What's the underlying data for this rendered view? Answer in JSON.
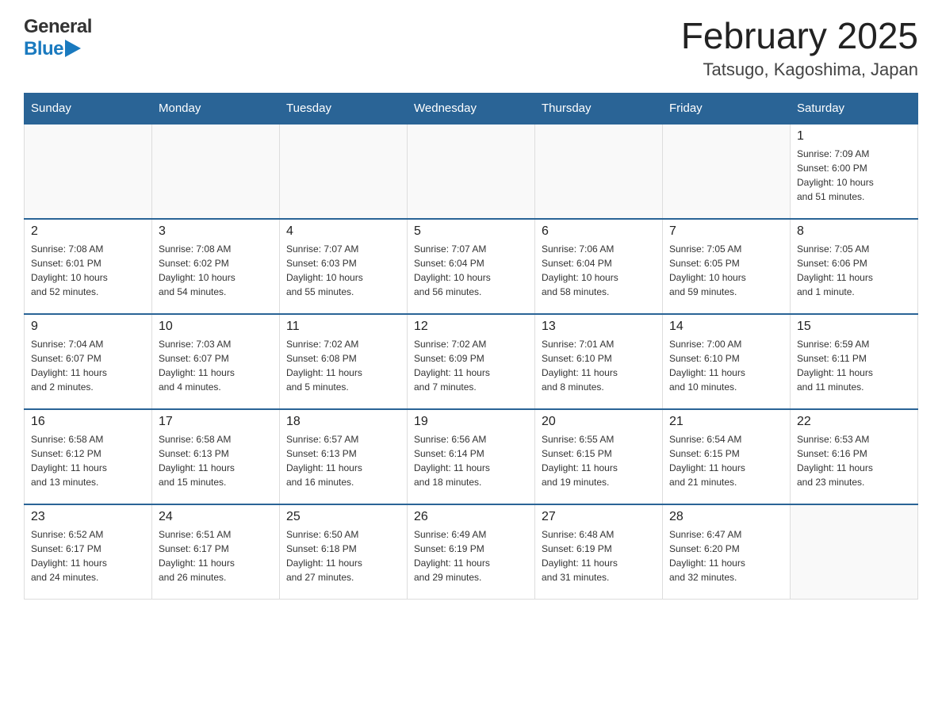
{
  "header": {
    "logo_line1": "General",
    "logo_line2": "Blue",
    "month_title": "February 2025",
    "location": "Tatsugo, Kagoshima, Japan"
  },
  "days_of_week": [
    "Sunday",
    "Monday",
    "Tuesday",
    "Wednesday",
    "Thursday",
    "Friday",
    "Saturday"
  ],
  "weeks": [
    [
      {
        "day": "",
        "info": ""
      },
      {
        "day": "",
        "info": ""
      },
      {
        "day": "",
        "info": ""
      },
      {
        "day": "",
        "info": ""
      },
      {
        "day": "",
        "info": ""
      },
      {
        "day": "",
        "info": ""
      },
      {
        "day": "1",
        "info": "Sunrise: 7:09 AM\nSunset: 6:00 PM\nDaylight: 10 hours\nand 51 minutes."
      }
    ],
    [
      {
        "day": "2",
        "info": "Sunrise: 7:08 AM\nSunset: 6:01 PM\nDaylight: 10 hours\nand 52 minutes."
      },
      {
        "day": "3",
        "info": "Sunrise: 7:08 AM\nSunset: 6:02 PM\nDaylight: 10 hours\nand 54 minutes."
      },
      {
        "day": "4",
        "info": "Sunrise: 7:07 AM\nSunset: 6:03 PM\nDaylight: 10 hours\nand 55 minutes."
      },
      {
        "day": "5",
        "info": "Sunrise: 7:07 AM\nSunset: 6:04 PM\nDaylight: 10 hours\nand 56 minutes."
      },
      {
        "day": "6",
        "info": "Sunrise: 7:06 AM\nSunset: 6:04 PM\nDaylight: 10 hours\nand 58 minutes."
      },
      {
        "day": "7",
        "info": "Sunrise: 7:05 AM\nSunset: 6:05 PM\nDaylight: 10 hours\nand 59 minutes."
      },
      {
        "day": "8",
        "info": "Sunrise: 7:05 AM\nSunset: 6:06 PM\nDaylight: 11 hours\nand 1 minute."
      }
    ],
    [
      {
        "day": "9",
        "info": "Sunrise: 7:04 AM\nSunset: 6:07 PM\nDaylight: 11 hours\nand 2 minutes."
      },
      {
        "day": "10",
        "info": "Sunrise: 7:03 AM\nSunset: 6:07 PM\nDaylight: 11 hours\nand 4 minutes."
      },
      {
        "day": "11",
        "info": "Sunrise: 7:02 AM\nSunset: 6:08 PM\nDaylight: 11 hours\nand 5 minutes."
      },
      {
        "day": "12",
        "info": "Sunrise: 7:02 AM\nSunset: 6:09 PM\nDaylight: 11 hours\nand 7 minutes."
      },
      {
        "day": "13",
        "info": "Sunrise: 7:01 AM\nSunset: 6:10 PM\nDaylight: 11 hours\nand 8 minutes."
      },
      {
        "day": "14",
        "info": "Sunrise: 7:00 AM\nSunset: 6:10 PM\nDaylight: 11 hours\nand 10 minutes."
      },
      {
        "day": "15",
        "info": "Sunrise: 6:59 AM\nSunset: 6:11 PM\nDaylight: 11 hours\nand 11 minutes."
      }
    ],
    [
      {
        "day": "16",
        "info": "Sunrise: 6:58 AM\nSunset: 6:12 PM\nDaylight: 11 hours\nand 13 minutes."
      },
      {
        "day": "17",
        "info": "Sunrise: 6:58 AM\nSunset: 6:13 PM\nDaylight: 11 hours\nand 15 minutes."
      },
      {
        "day": "18",
        "info": "Sunrise: 6:57 AM\nSunset: 6:13 PM\nDaylight: 11 hours\nand 16 minutes."
      },
      {
        "day": "19",
        "info": "Sunrise: 6:56 AM\nSunset: 6:14 PM\nDaylight: 11 hours\nand 18 minutes."
      },
      {
        "day": "20",
        "info": "Sunrise: 6:55 AM\nSunset: 6:15 PM\nDaylight: 11 hours\nand 19 minutes."
      },
      {
        "day": "21",
        "info": "Sunrise: 6:54 AM\nSunset: 6:15 PM\nDaylight: 11 hours\nand 21 minutes."
      },
      {
        "day": "22",
        "info": "Sunrise: 6:53 AM\nSunset: 6:16 PM\nDaylight: 11 hours\nand 23 minutes."
      }
    ],
    [
      {
        "day": "23",
        "info": "Sunrise: 6:52 AM\nSunset: 6:17 PM\nDaylight: 11 hours\nand 24 minutes."
      },
      {
        "day": "24",
        "info": "Sunrise: 6:51 AM\nSunset: 6:17 PM\nDaylight: 11 hours\nand 26 minutes."
      },
      {
        "day": "25",
        "info": "Sunrise: 6:50 AM\nSunset: 6:18 PM\nDaylight: 11 hours\nand 27 minutes."
      },
      {
        "day": "26",
        "info": "Sunrise: 6:49 AM\nSunset: 6:19 PM\nDaylight: 11 hours\nand 29 minutes."
      },
      {
        "day": "27",
        "info": "Sunrise: 6:48 AM\nSunset: 6:19 PM\nDaylight: 11 hours\nand 31 minutes."
      },
      {
        "day": "28",
        "info": "Sunrise: 6:47 AM\nSunset: 6:20 PM\nDaylight: 11 hours\nand 32 minutes."
      },
      {
        "day": "",
        "info": ""
      }
    ]
  ]
}
